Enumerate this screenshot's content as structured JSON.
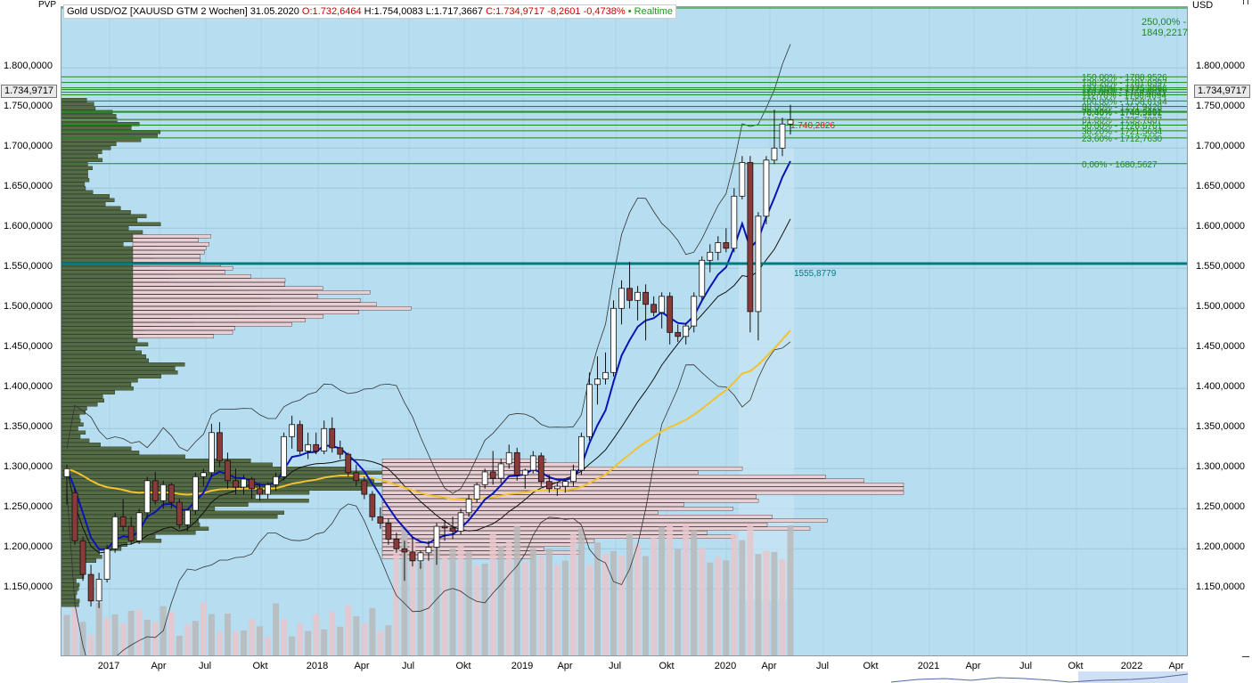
{
  "title": {
    "instrument": "Gold USD/OZ [XAUUSD GTM 2 Wochen] 31.05.2020",
    "open": "O:1.732,6464",
    "high": "H:1.754,0083",
    "low": "L:1.717,3667",
    "close": "C:1.734,9717",
    "change": "-8,2601",
    "change_pct": "-0,4738%",
    "realtime": "• Realtime"
  },
  "labels": {
    "pvp": "PVP",
    "currency": "USD",
    "current_price": "1.734,9717",
    "current_price_mark": "1.740,2826",
    "support_line": "1555,8779"
  },
  "colors": {
    "background": "#b7def0",
    "bull": "#ffffff",
    "bear": "#8b3a3a",
    "ema_fast": "#0a14b4",
    "ema_mid": "#111111",
    "sma_slow": "#f2c230",
    "support": "#007c80",
    "fib": "#1d8a1d",
    "bollinger": "#333333",
    "profile_left": "#556b46",
    "profile_right": "#e8cfd4"
  },
  "fib_levels": [
    {
      "label": "250,00% - 1849,2217"
    },
    {
      "label": "150,00% - 1788,9526"
    },
    {
      "label": "138,20% - 1781,8397"
    },
    {
      "label": "127,20% - 1775,2096"
    },
    {
      "label": "123,60% - 1773,0396"
    },
    {
      "label": "118,00% - 1769,6641"
    },
    {
      "label": "112,70% - 1766,4694"
    },
    {
      "label": "100,00% - 1758,8144"
    },
    {
      "label": "88,60% - 1751,9428"
    },
    {
      "label": "78,60% - 1745,9152"
    },
    {
      "label": "76,40% - 1744,5891"
    },
    {
      "label": "61,80% - 1735,7887"
    },
    {
      "label": "50,00% - 1728,6761"
    },
    {
      "label": "38,20% - 1721,5634"
    },
    {
      "label": "23,60% - 1712,7630"
    },
    {
      "label": "0,00% - 1680,5627"
    }
  ],
  "chart_data": {
    "type": "candlestick",
    "title": "Gold USD/OZ [XAUUSD GTM 2 Wochen]",
    "interval": "2 weeks",
    "ylim": [
      1120,
      1850
    ],
    "y_ticks": [
      "1.150,0000",
      "1.200,0000",
      "1.250,0000",
      "1.300,0000",
      "1.350,0000",
      "1.400,0000",
      "1.450,0000",
      "1.500,0000",
      "1.550,0000",
      "1.600,0000",
      "1.650,0000",
      "1.700,0000",
      "1.750,0000",
      "1.800,0000"
    ],
    "y_tick_values": [
      1150,
      1200,
      1250,
      1300,
      1350,
      1400,
      1450,
      1500,
      1550,
      1600,
      1650,
      1700,
      1750,
      1800
    ],
    "x_ticks": [
      "2017",
      "Apr",
      "Jul",
      "Okt",
      "2018",
      "Apr",
      "Jul",
      "Okt",
      "2019",
      "Apr",
      "Jul",
      "Okt",
      "2020",
      "Apr",
      "Jul",
      "Okt",
      "2021",
      "Apr",
      "Jul",
      "Okt",
      "2022",
      "Apr"
    ],
    "support_level": 1555.8779,
    "candles": [
      {
        "o": 1290,
        "h": 1305,
        "l": 1255,
        "c": 1300
      },
      {
        "o": 1270,
        "h": 1275,
        "l": 1205,
        "c": 1210
      },
      {
        "o": 1210,
        "h": 1215,
        "l": 1160,
        "c": 1168
      },
      {
        "o": 1168,
        "h": 1180,
        "l": 1128,
        "c": 1135
      },
      {
        "o": 1135,
        "h": 1170,
        "l": 1126,
        "c": 1162
      },
      {
        "o": 1162,
        "h": 1205,
        "l": 1158,
        "c": 1200
      },
      {
        "o": 1200,
        "h": 1245,
        "l": 1195,
        "c": 1240
      },
      {
        "o": 1240,
        "h": 1262,
        "l": 1222,
        "c": 1228
      },
      {
        "o": 1228,
        "h": 1240,
        "l": 1205,
        "c": 1210
      },
      {
        "o": 1210,
        "h": 1250,
        "l": 1206,
        "c": 1245
      },
      {
        "o": 1245,
        "h": 1290,
        "l": 1238,
        "c": 1285
      },
      {
        "o": 1285,
        "h": 1296,
        "l": 1255,
        "c": 1260
      },
      {
        "o": 1260,
        "h": 1285,
        "l": 1250,
        "c": 1280
      },
      {
        "o": 1280,
        "h": 1282,
        "l": 1250,
        "c": 1258
      },
      {
        "o": 1258,
        "h": 1262,
        "l": 1225,
        "c": 1230
      },
      {
        "o": 1230,
        "h": 1250,
        "l": 1222,
        "c": 1248
      },
      {
        "o": 1248,
        "h": 1295,
        "l": 1243,
        "c": 1290
      },
      {
        "o": 1290,
        "h": 1300,
        "l": 1278,
        "c": 1295
      },
      {
        "o": 1295,
        "h": 1356,
        "l": 1290,
        "c": 1345
      },
      {
        "o": 1345,
        "h": 1358,
        "l": 1302,
        "c": 1310
      },
      {
        "o": 1310,
        "h": 1320,
        "l": 1275,
        "c": 1285
      },
      {
        "o": 1285,
        "h": 1300,
        "l": 1268,
        "c": 1277
      },
      {
        "o": 1277,
        "h": 1292,
        "l": 1268,
        "c": 1287
      },
      {
        "o": 1287,
        "h": 1290,
        "l": 1262,
        "c": 1275
      },
      {
        "o": 1275,
        "h": 1282,
        "l": 1260,
        "c": 1268
      },
      {
        "o": 1268,
        "h": 1283,
        "l": 1262,
        "c": 1280
      },
      {
        "o": 1280,
        "h": 1295,
        "l": 1272,
        "c": 1290
      },
      {
        "o": 1290,
        "h": 1345,
        "l": 1285,
        "c": 1340
      },
      {
        "o": 1340,
        "h": 1366,
        "l": 1325,
        "c": 1355
      },
      {
        "o": 1355,
        "h": 1360,
        "l": 1318,
        "c": 1322
      },
      {
        "o": 1322,
        "h": 1345,
        "l": 1312,
        "c": 1330
      },
      {
        "o": 1330,
        "h": 1345,
        "l": 1318,
        "c": 1322
      },
      {
        "o": 1322,
        "h": 1360,
        "l": 1318,
        "c": 1350
      },
      {
        "o": 1350,
        "h": 1364,
        "l": 1320,
        "c": 1326
      },
      {
        "o": 1326,
        "h": 1335,
        "l": 1312,
        "c": 1318
      },
      {
        "o": 1318,
        "h": 1320,
        "l": 1290,
        "c": 1295
      },
      {
        "o": 1295,
        "h": 1305,
        "l": 1278,
        "c": 1285
      },
      {
        "o": 1285,
        "h": 1290,
        "l": 1262,
        "c": 1268
      },
      {
        "o": 1268,
        "h": 1272,
        "l": 1235,
        "c": 1240
      },
      {
        "o": 1240,
        "h": 1252,
        "l": 1225,
        "c": 1232
      },
      {
        "o": 1232,
        "h": 1238,
        "l": 1205,
        "c": 1212
      },
      {
        "o": 1212,
        "h": 1220,
        "l": 1195,
        "c": 1200
      },
      {
        "o": 1200,
        "h": 1210,
        "l": 1160,
        "c": 1196
      },
      {
        "o": 1196,
        "h": 1215,
        "l": 1178,
        "c": 1185
      },
      {
        "o": 1185,
        "h": 1198,
        "l": 1175,
        "c": 1195
      },
      {
        "o": 1195,
        "h": 1210,
        "l": 1185,
        "c": 1202
      },
      {
        "o": 1202,
        "h": 1232,
        "l": 1180,
        "c": 1228
      },
      {
        "o": 1228,
        "h": 1236,
        "l": 1210,
        "c": 1226
      },
      {
        "o": 1226,
        "h": 1240,
        "l": 1212,
        "c": 1222
      },
      {
        "o": 1222,
        "h": 1250,
        "l": 1218,
        "c": 1245
      },
      {
        "o": 1245,
        "h": 1268,
        "l": 1240,
        "c": 1262
      },
      {
        "o": 1262,
        "h": 1283,
        "l": 1258,
        "c": 1280
      },
      {
        "o": 1280,
        "h": 1300,
        "l": 1275,
        "c": 1296
      },
      {
        "o": 1296,
        "h": 1322,
        "l": 1280,
        "c": 1288
      },
      {
        "o": 1288,
        "h": 1312,
        "l": 1282,
        "c": 1306
      },
      {
        "o": 1306,
        "h": 1330,
        "l": 1300,
        "c": 1320
      },
      {
        "o": 1320,
        "h": 1326,
        "l": 1285,
        "c": 1292
      },
      {
        "o": 1292,
        "h": 1300,
        "l": 1275,
        "c": 1298
      },
      {
        "o": 1298,
        "h": 1322,
        "l": 1294,
        "c": 1316
      },
      {
        "o": 1316,
        "h": 1320,
        "l": 1278,
        "c": 1284
      },
      {
        "o": 1284,
        "h": 1292,
        "l": 1270,
        "c": 1275
      },
      {
        "o": 1275,
        "h": 1282,
        "l": 1266,
        "c": 1278
      },
      {
        "o": 1278,
        "h": 1286,
        "l": 1270,
        "c": 1284
      },
      {
        "o": 1284,
        "h": 1305,
        "l": 1278,
        "c": 1298
      },
      {
        "o": 1298,
        "h": 1345,
        "l": 1292,
        "c": 1340
      },
      {
        "o": 1340,
        "h": 1420,
        "l": 1335,
        "c": 1405
      },
      {
        "o": 1405,
        "h": 1440,
        "l": 1380,
        "c": 1412
      },
      {
        "o": 1412,
        "h": 1445,
        "l": 1405,
        "c": 1420
      },
      {
        "o": 1420,
        "h": 1510,
        "l": 1415,
        "c": 1500
      },
      {
        "o": 1500,
        "h": 1535,
        "l": 1480,
        "c": 1525
      },
      {
        "o": 1525,
        "h": 1558,
        "l": 1500,
        "c": 1510
      },
      {
        "o": 1510,
        "h": 1528,
        "l": 1485,
        "c": 1520
      },
      {
        "o": 1520,
        "h": 1530,
        "l": 1460,
        "c": 1505
      },
      {
        "o": 1505,
        "h": 1515,
        "l": 1490,
        "c": 1495
      },
      {
        "o": 1495,
        "h": 1520,
        "l": 1475,
        "c": 1515
      },
      {
        "o": 1515,
        "h": 1520,
        "l": 1455,
        "c": 1470
      },
      {
        "o": 1470,
        "h": 1480,
        "l": 1458,
        "c": 1465
      },
      {
        "o": 1465,
        "h": 1482,
        "l": 1455,
        "c": 1478
      },
      {
        "o": 1478,
        "h": 1520,
        "l": 1470,
        "c": 1515
      },
      {
        "o": 1515,
        "h": 1565,
        "l": 1510,
        "c": 1560
      },
      {
        "o": 1560,
        "h": 1580,
        "l": 1545,
        "c": 1570
      },
      {
        "o": 1570,
        "h": 1590,
        "l": 1560,
        "c": 1582
      },
      {
        "o": 1582,
        "h": 1600,
        "l": 1570,
        "c": 1575
      },
      {
        "o": 1575,
        "h": 1650,
        "l": 1570,
        "c": 1640
      },
      {
        "o": 1640,
        "h": 1690,
        "l": 1636,
        "c": 1682
      },
      {
        "o": 1682,
        "h": 1690,
        "l": 1470,
        "c": 1496
      },
      {
        "o": 1496,
        "h": 1620,
        "l": 1460,
        "c": 1615
      },
      {
        "o": 1615,
        "h": 1690,
        "l": 1605,
        "c": 1685
      },
      {
        "o": 1685,
        "h": 1748,
        "l": 1680,
        "c": 1700
      },
      {
        "o": 1700,
        "h": 1738,
        "l": 1690,
        "c": 1730
      },
      {
        "o": 1730,
        "h": 1754,
        "l": 1717,
        "c": 1735
      }
    ]
  }
}
